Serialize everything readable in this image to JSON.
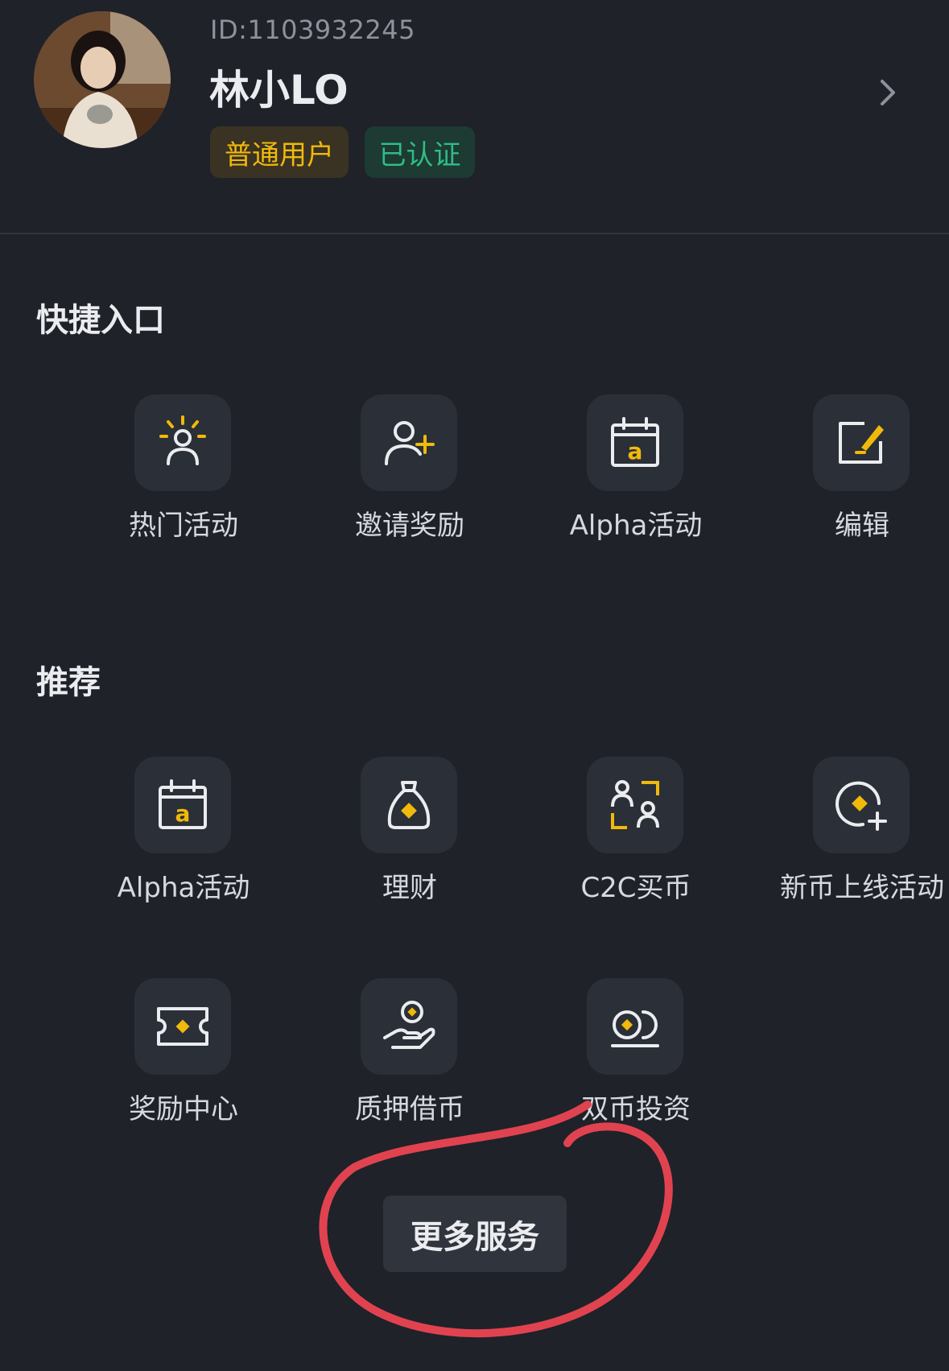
{
  "profile": {
    "id_text": "ID:1103932245",
    "name": "林小LO",
    "badges": [
      {
        "label": "普通用户",
        "color": "#f0b90b"
      },
      {
        "label": "已认证",
        "color": "#2ebd85"
      }
    ]
  },
  "quick_entry": {
    "title": "快捷入口",
    "items": [
      {
        "label": "热门活动",
        "icon": "hot-activity-icon"
      },
      {
        "label": "邀请奖励",
        "icon": "invite-reward-icon"
      },
      {
        "label": "Alpha活动",
        "icon": "alpha-calendar-icon"
      },
      {
        "label": "编辑",
        "icon": "edit-icon"
      }
    ]
  },
  "recommended": {
    "title": "推荐",
    "items": [
      {
        "label": "Alpha活动",
        "icon": "alpha-calendar-icon"
      },
      {
        "label": "理财",
        "icon": "money-bag-icon"
      },
      {
        "label": "C2C买币",
        "icon": "c2c-icon"
      },
      {
        "label": "新币上线活动",
        "icon": "new-coin-icon"
      },
      {
        "label": "奖励中心",
        "icon": "ticket-icon"
      },
      {
        "label": "质押借币",
        "icon": "loan-hand-icon"
      },
      {
        "label": "双币投资",
        "icon": "dual-coin-icon"
      }
    ]
  },
  "more_services": {
    "label": "更多服务"
  },
  "colors": {
    "background": "#1f2229",
    "tile": "#2b2f37",
    "accent": "#f0b90b",
    "annotation": "#e0434f"
  }
}
